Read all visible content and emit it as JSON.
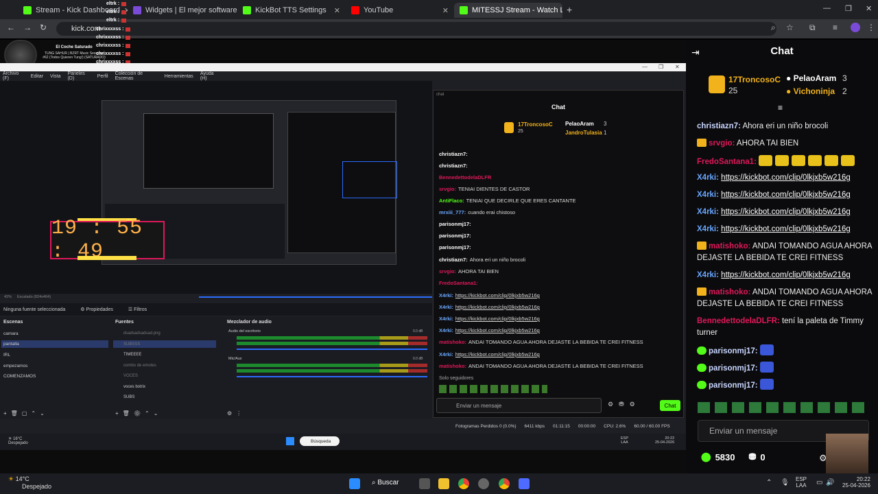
{
  "browser": {
    "tabs": [
      {
        "label": "Stream - Kick Dashboard",
        "color": "#53fc18"
      },
      {
        "label": "Widgets | El mejor software pa",
        "color": "#7a4bd9"
      },
      {
        "label": "KickBot TTS Settings",
        "color": "#53fc18"
      },
      {
        "label": "YouTube",
        "color": "#ff0000"
      },
      {
        "label": "MITESSJ Stream - Watch Li",
        "color": "#53fc18"
      }
    ],
    "url": "kick.com"
  },
  "overlay": {
    "user1": "eltrk :",
    "user2": "chrixxxxss :",
    "now_playing_title": "El Coche Saturado",
    "now_playing_sub": "TUNG SAHUR | BZRT Music Sessions #62 (Todos Quieren Tung!) (SATURADO)"
  },
  "obs": {
    "menu": [
      "Archivo (F)",
      "Editar",
      "Vista",
      "Paneles (D)",
      "Perfil",
      "Colección de Escenas",
      "Herramientas",
      "Ayuda (H)"
    ],
    "timer": "19 : 55 : 49",
    "zoom": "42%",
    "scaled": "Escalado (824x464)",
    "no_source": "Ninguna fuente seleccionada",
    "props": "Propiedades",
    "filters": "Filtros",
    "scenes_title": "Escenas",
    "sources_title": "Fuentes",
    "mixer_title": "Mezclador de audio",
    "scenes": [
      "camara",
      "pantalla",
      "IRL",
      "empezamos",
      "COMENZAMOS"
    ],
    "sources": [
      "dsadsadsadsad.png",
      "SUBSSS",
      "TIMEEEE",
      "combo de emotes",
      "VOCES",
      "voces botrix",
      "SUBS"
    ],
    "audio1": "Audio del escritorio",
    "audio2": "Mic/Aux",
    "db": "0.0 dB",
    "status": [
      "Fotogramas Perdidos 0 (0.0%)",
      "6411 kbps",
      "01:11:15",
      "00:00:00",
      "CPU: 2.6%",
      "60.00 / 60.00 FPS"
    ]
  },
  "inner_chat": {
    "window_title": "chat",
    "title": "Chat",
    "rank1": "17TroncosoC",
    "rank1_score": "25",
    "rank2": "PelaoAram",
    "rank2_score": "3",
    "rank3": "JandroTulasia",
    "rank3_score": "1",
    "messages": [
      {
        "user": "christiazn7:",
        "text": "",
        "color": "#ffffff"
      },
      {
        "user": "christiazn7:",
        "text": "",
        "color": "#ffffff"
      },
      {
        "user": "BennedettodelaDLFR",
        "text": "",
        "color": "#e0185a"
      },
      {
        "user": "srvgio:",
        "text": "TENIAI DIENTES DE CASTOR",
        "color": "#e0185a"
      },
      {
        "user": "AntiFlaco:",
        "text": "TENIAI QUE DECIRLE QUE ERES CANTANTE",
        "color": "#53fc18"
      },
      {
        "user": "mrxiii_777:",
        "text": "cuando erai chistoso",
        "color": "#6aa8ff"
      },
      {
        "user": "parisonmj17:",
        "text": "",
        "color": "#ffffff"
      },
      {
        "user": "parisonmj17:",
        "text": "",
        "color": "#ffffff"
      },
      {
        "user": "parisonmj17:",
        "text": "",
        "color": "#ffffff"
      },
      {
        "user": "christiazn7:",
        "text": "Ahora eri un niño brocoli",
        "color": "#ffffff"
      },
      {
        "user": "srvgio:",
        "text": "AHORA TAI BIEN",
        "color": "#e0185a"
      },
      {
        "user": "FredoSantana1:",
        "text": "",
        "color": "#e0185a"
      },
      {
        "user": "X4rki:",
        "text": "https://kickbot.com/clip/0lkjxb5w216g",
        "color": "#6aa8ff"
      },
      {
        "user": "X4rki:",
        "text": "https://kickbot.com/clip/0lkjxb5w216g",
        "color": "#6aa8ff"
      },
      {
        "user": "X4rki:",
        "text": "https://kickbot.com/clip/0lkjxb5w216g",
        "color": "#6aa8ff"
      },
      {
        "user": "X4rki:",
        "text": "https://kickbot.com/clip/0lkjxb5w216g",
        "color": "#6aa8ff"
      },
      {
        "user": "matishoko:",
        "text": "ANDAI TOMANDO AGUA AHORA DEJASTE LA BEBIDA TE CREI FITNESS",
        "color": "#e0185a"
      },
      {
        "user": "X4rki:",
        "text": "https://kickbot.com/clip/0lkjxb5w216g",
        "color": "#6aa8ff"
      },
      {
        "user": "matishoko:",
        "text": "ANDAI TOMANDO AGUA AHORA DEJASTE LA BEBIDA TE CREI FITNESS",
        "color": "#e0185a"
      }
    ],
    "followers": "Solo seguidores",
    "placeholder": "Enviar un mensaje",
    "send": "Chat"
  },
  "inner_taskbar": {
    "weather_temp": "16°C",
    "weather_desc": "Despejado",
    "search": "Búsqueda",
    "lang": "ESP",
    "lang2": "LAA",
    "time": "20:22",
    "date": "25-04-2026"
  },
  "chat": {
    "title": "Chat",
    "rank1_name": "17TroncosoC",
    "rank1_score": "25",
    "rank2_name": "PelaoAram",
    "rank2_score": "3",
    "rank3_name": "Vichoninja",
    "rank3_score": "2",
    "messages": [
      {
        "user": "christiazn7:",
        "text": "Ahora eri un niño brocoli",
        "color": "#c9d6ff"
      },
      {
        "user": "srvgio:",
        "text": "AHORA TAI BIEN",
        "color": "#e0185a"
      },
      {
        "user": "FredoSantana1:",
        "text": "",
        "color": "#e0185a"
      },
      {
        "user": "X4rki:",
        "text": "https://kickbot.com/clip/0lkjxb5w216g",
        "color": "#6aa8ff"
      },
      {
        "user": "X4rki:",
        "text": "https://kickbot.com/clip/0lkjxb5w216g",
        "color": "#6aa8ff"
      },
      {
        "user": "X4rki:",
        "text": "https://kickbot.com/clip/0lkjxb5w216g",
        "color": "#6aa8ff"
      },
      {
        "user": "X4rki:",
        "text": "https://kickbot.com/clip/0lkjxb5w216g",
        "color": "#6aa8ff"
      },
      {
        "user": "matishoko:",
        "text": "ANDAI TOMANDO AGUA AHORA DEJASTE LA BEBIDA TE CREI FITNESS",
        "color": "#e0185a"
      },
      {
        "user": "X4rki:",
        "text": "https://kickbot.com/clip/0lkjxb5w216g",
        "color": "#6aa8ff"
      },
      {
        "user": "matishoko:",
        "text": "ANDAI TOMANDO AGUA AHORA DEJASTE LA BEBIDA TE CREI FITNESS",
        "color": "#e0185a"
      },
      {
        "user": "BennedettodelaDLFR:",
        "text": "tení la paleta de Timmy turner",
        "color": "#e0185a"
      },
      {
        "user": "parisonmj17:",
        "text": "",
        "color": "#c9d6ff"
      },
      {
        "user": "parisonmj17:",
        "text": "",
        "color": "#c9d6ff"
      },
      {
        "user": "parisonmj17:",
        "text": "",
        "color": "#c9d6ff"
      }
    ],
    "placeholder": "Enviar un mensaje",
    "points": "5830",
    "store_count": "0"
  },
  "taskbar": {
    "weather_temp": "14°C",
    "weather_desc": "Despejado",
    "search": "Buscar",
    "lang": "ESP",
    "lang2": "LAA",
    "time": "20:22",
    "date": "25-04-2026"
  },
  "colors": {
    "kick_green": "#53fc18",
    "accent_red": "#e0185a",
    "gold": "#f2b21b"
  }
}
